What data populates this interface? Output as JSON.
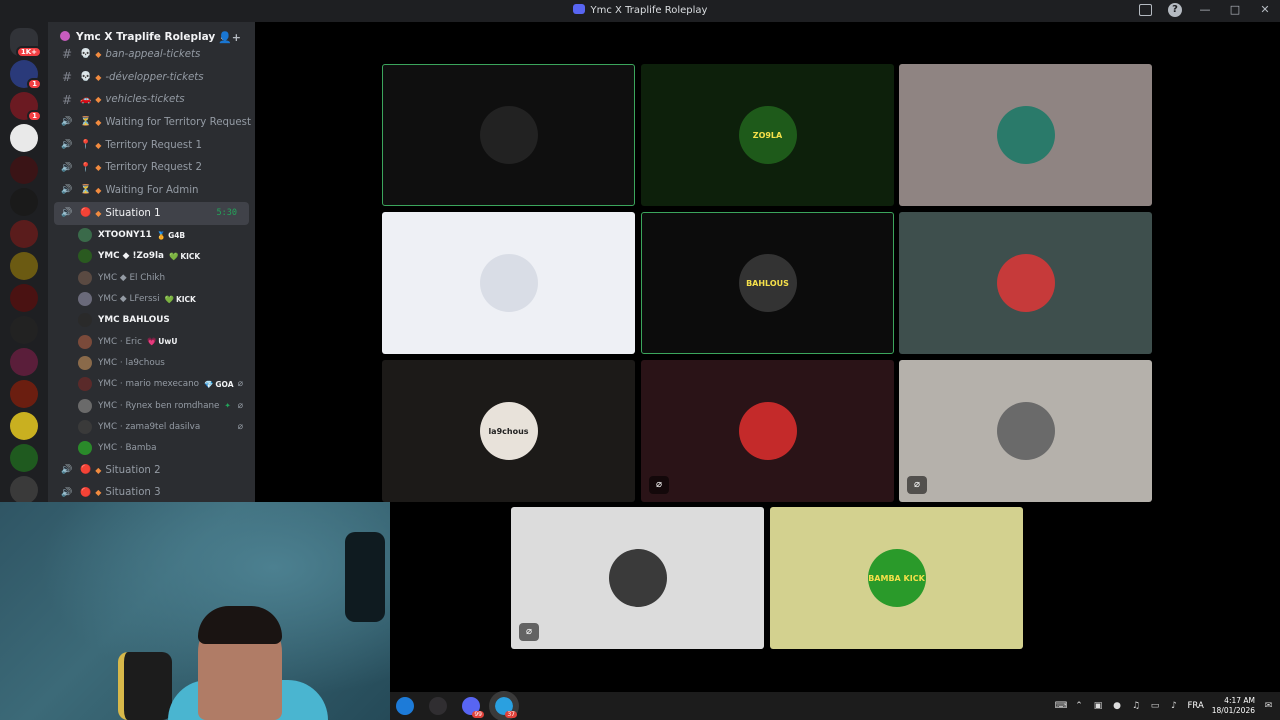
{
  "window": {
    "title": "Ymc X Traplife Roleplay",
    "icons": [
      "inbox-icon",
      "help-icon",
      "minimize-icon",
      "maximize-icon",
      "close-icon"
    ]
  },
  "server_rail": {
    "items": [
      {
        "name": "direct-messages",
        "badge": "1K+",
        "color": "#313338"
      },
      {
        "name": "server-1",
        "badge": "1",
        "color": "#2a3a7a"
      },
      {
        "name": "server-2",
        "badge": "1",
        "color": "#6b1a22"
      },
      {
        "name": "server-3",
        "badge": "",
        "color": "#e9e9e9"
      },
      {
        "name": "server-ymc-1",
        "badge": "",
        "color": "#3a1416"
      },
      {
        "name": "server-ymc-2",
        "badge": "",
        "color": "#1a1a1a"
      },
      {
        "name": "server-4",
        "badge": "",
        "color": "#5a1c1c"
      },
      {
        "name": "server-bamba",
        "badge": "",
        "color": "#6b5a12"
      },
      {
        "name": "server-5",
        "badge": "",
        "color": "#4a1212"
      },
      {
        "name": "server-ymc-3",
        "badge": "",
        "color": "#222"
      },
      {
        "name": "server-6",
        "badge": "",
        "color": "#5a1e3a"
      },
      {
        "name": "server-otherside",
        "badge": "",
        "color": "#6b1e10"
      },
      {
        "name": "server-7",
        "badge": "",
        "color": "#c9b020"
      },
      {
        "name": "server-8",
        "badge": "",
        "color": "#1f5a1f"
      },
      {
        "name": "server-9",
        "badge": "",
        "color": "#3a3a3a"
      }
    ]
  },
  "sidebar": {
    "guild_name": "Ymc X Traplife Roleplay",
    "channels_top": [
      {
        "type": "text",
        "emoji": "💀",
        "label": "ban-appeal-tickets",
        "italic": true
      },
      {
        "type": "text",
        "emoji": "💀",
        "label": "-développer-tickets",
        "italic": true
      },
      {
        "type": "text",
        "emoji": "🚗",
        "label": "vehicles-tickets",
        "italic": true
      },
      {
        "type": "voice",
        "emoji": "⏳",
        "label": "Waiting for Territory Request",
        "italic": false
      },
      {
        "type": "voice",
        "emoji": "📍",
        "label": "Territory Request 1",
        "italic": false
      },
      {
        "type": "voice",
        "emoji": "📍",
        "label": "Territory Request 2",
        "italic": false
      },
      {
        "type": "voice",
        "emoji": "⏳",
        "label": "Waiting For Admin",
        "italic": false
      }
    ],
    "active_channel": {
      "emoji": "🔴",
      "label": "Situation 1",
      "timer": "5:30"
    },
    "members": [
      {
        "name": "XTOONY11",
        "tag": "G4B",
        "tag_icon": "🏅",
        "bold": true,
        "color": "#3a6a4a",
        "muted": false
      },
      {
        "name": "YMC ◆ !Zo9la",
        "tag": "KICK",
        "tag_icon": "💚",
        "bold": true,
        "color": "#2a5a20",
        "muted": false
      },
      {
        "name": "YMC ◆ El Chikh",
        "tag": "",
        "tag_icon": "",
        "bold": false,
        "color": "#5a4a42",
        "muted": false
      },
      {
        "name": "YMC ◆ LFerssi",
        "tag": "KICK",
        "tag_icon": "💚",
        "bold": false,
        "color": "#6a6a7a",
        "muted": false
      },
      {
        "name": "YMC  BAHLOUS",
        "tag": "",
        "tag_icon": "",
        "bold": true,
        "color": "#2a2a2a",
        "muted": false
      },
      {
        "name": "YMC · Eric",
        "tag": "UwU",
        "tag_icon": "💗",
        "bold": false,
        "color": "#7a4a3a",
        "muted": false
      },
      {
        "name": "YMC · la9chous",
        "tag": "",
        "tag_icon": "",
        "bold": false,
        "color": "#8a6a4a",
        "muted": false
      },
      {
        "name": "YMC · mario mexecano",
        "tag": "GOA",
        "tag_icon": "💎",
        "bold": false,
        "color": "#5a2a2a",
        "muted": true
      },
      {
        "name": "YMC · Rynex ben romdhane",
        "tag": "",
        "tag_icon": "✦",
        "bold": false,
        "color": "#6a6a6a",
        "muted": true
      },
      {
        "name": "YMC · zama9tel dasilva",
        "tag": "",
        "tag_icon": "",
        "bold": false,
        "color": "#3a3a3a",
        "muted": true
      },
      {
        "name": "YMC · Bamba",
        "tag": "",
        "tag_icon": "",
        "bold": false,
        "color": "#2a8a2a",
        "muted": false
      }
    ],
    "channels_bottom": [
      {
        "type": "voice",
        "emoji": "🔴",
        "label": "Situation 2"
      },
      {
        "type": "voice",
        "emoji": "🔴",
        "label": "Situation 3"
      }
    ]
  },
  "tiles": [
    {
      "name": "tile-xtoony",
      "bg": "#0f0f0f",
      "avatar_bg": "#222",
      "avatar_text": "",
      "speaking": true,
      "muted": false
    },
    {
      "name": "tile-zo9la",
      "bg": "#0d200b",
      "avatar_bg": "#1e5a1a",
      "avatar_text": "ZO9LA",
      "speaking": false,
      "muted": false
    },
    {
      "name": "tile-elchikh",
      "bg": "#8f8482",
      "avatar_bg": "#2a7a6a",
      "avatar_text": "",
      "speaking": false,
      "muted": false
    },
    {
      "name": "tile-lferssi",
      "bg": "#eef0f5",
      "avatar_bg": "#d9dde6",
      "avatar_text": "",
      "speaking": false,
      "muted": false
    },
    {
      "name": "tile-bahlous",
      "bg": "#0c0c0c",
      "avatar_bg": "#333",
      "avatar_text": "BAHLOUS",
      "speaking": true,
      "muted": false
    },
    {
      "name": "tile-eric",
      "bg": "#3e4f4d",
      "avatar_bg": "#c63a3a",
      "avatar_text": "",
      "speaking": false,
      "muted": false
    },
    {
      "name": "tile-la9chous",
      "bg": "#1c1a18",
      "avatar_bg": "#e8e2da",
      "avatar_text": "la9chous",
      "speaking": false,
      "muted": false
    },
    {
      "name": "tile-mario",
      "bg": "#2a1317",
      "avatar_bg": "#c42a2a",
      "avatar_text": "",
      "speaking": false,
      "muted": true
    },
    {
      "name": "tile-rynex",
      "bg": "#b5b1ab",
      "avatar_bg": "#6a6a6a",
      "avatar_text": "",
      "speaking": false,
      "muted": true
    },
    {
      "name": "tile-zama9tel",
      "bg": "#dcdcdc",
      "avatar_bg": "#3a3a3a",
      "avatar_text": "",
      "speaking": false,
      "muted": true
    },
    {
      "name": "tile-bamba",
      "bg": "#d3d18f",
      "avatar_bg": "#2a9a2a",
      "avatar_text": "BAMBA KICK",
      "speaking": false,
      "muted": false
    }
  ],
  "taskbar": {
    "apps": [
      {
        "name": "edge-app",
        "color": "#1d7bd8",
        "badge": ""
      },
      {
        "name": "obs-app",
        "color": "#302e31",
        "badge": ""
      },
      {
        "name": "discord-app",
        "color": "#5865f2",
        "badge": "99"
      },
      {
        "name": "telegram-app",
        "color": "#2aa0e0",
        "badge": "37"
      }
    ],
    "language": "FRA",
    "time": "4:17 AM",
    "date": "18/01/2026"
  }
}
